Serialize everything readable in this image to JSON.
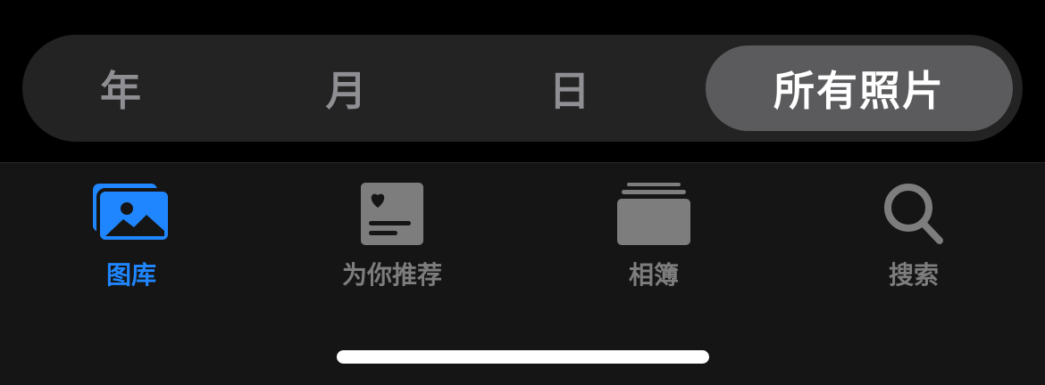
{
  "segments": {
    "year": "年",
    "month": "月",
    "day": "日",
    "all_photos": "所有照片",
    "selected": "all_photos"
  },
  "tabbar": {
    "library": {
      "label": "图库",
      "icon": "photo-library-icon",
      "active": true
    },
    "for_you": {
      "label": "为你推荐",
      "icon": "for-you-icon",
      "active": false
    },
    "albums": {
      "label": "相簿",
      "icon": "albums-icon",
      "active": false
    },
    "search": {
      "label": "搜索",
      "icon": "search-icon",
      "active": false
    }
  },
  "colors": {
    "background": "#000000",
    "segmented_bg": "#232323",
    "segment_selected_bg": "#5b5b5e",
    "segment_text": "#8e8e93",
    "segment_selected_text": "#ffffff",
    "tabbar_bg": "#151515",
    "tab_active": "#1f86ff",
    "tab_inactive": "#7d7d7d",
    "home_indicator": "#ffffff"
  }
}
